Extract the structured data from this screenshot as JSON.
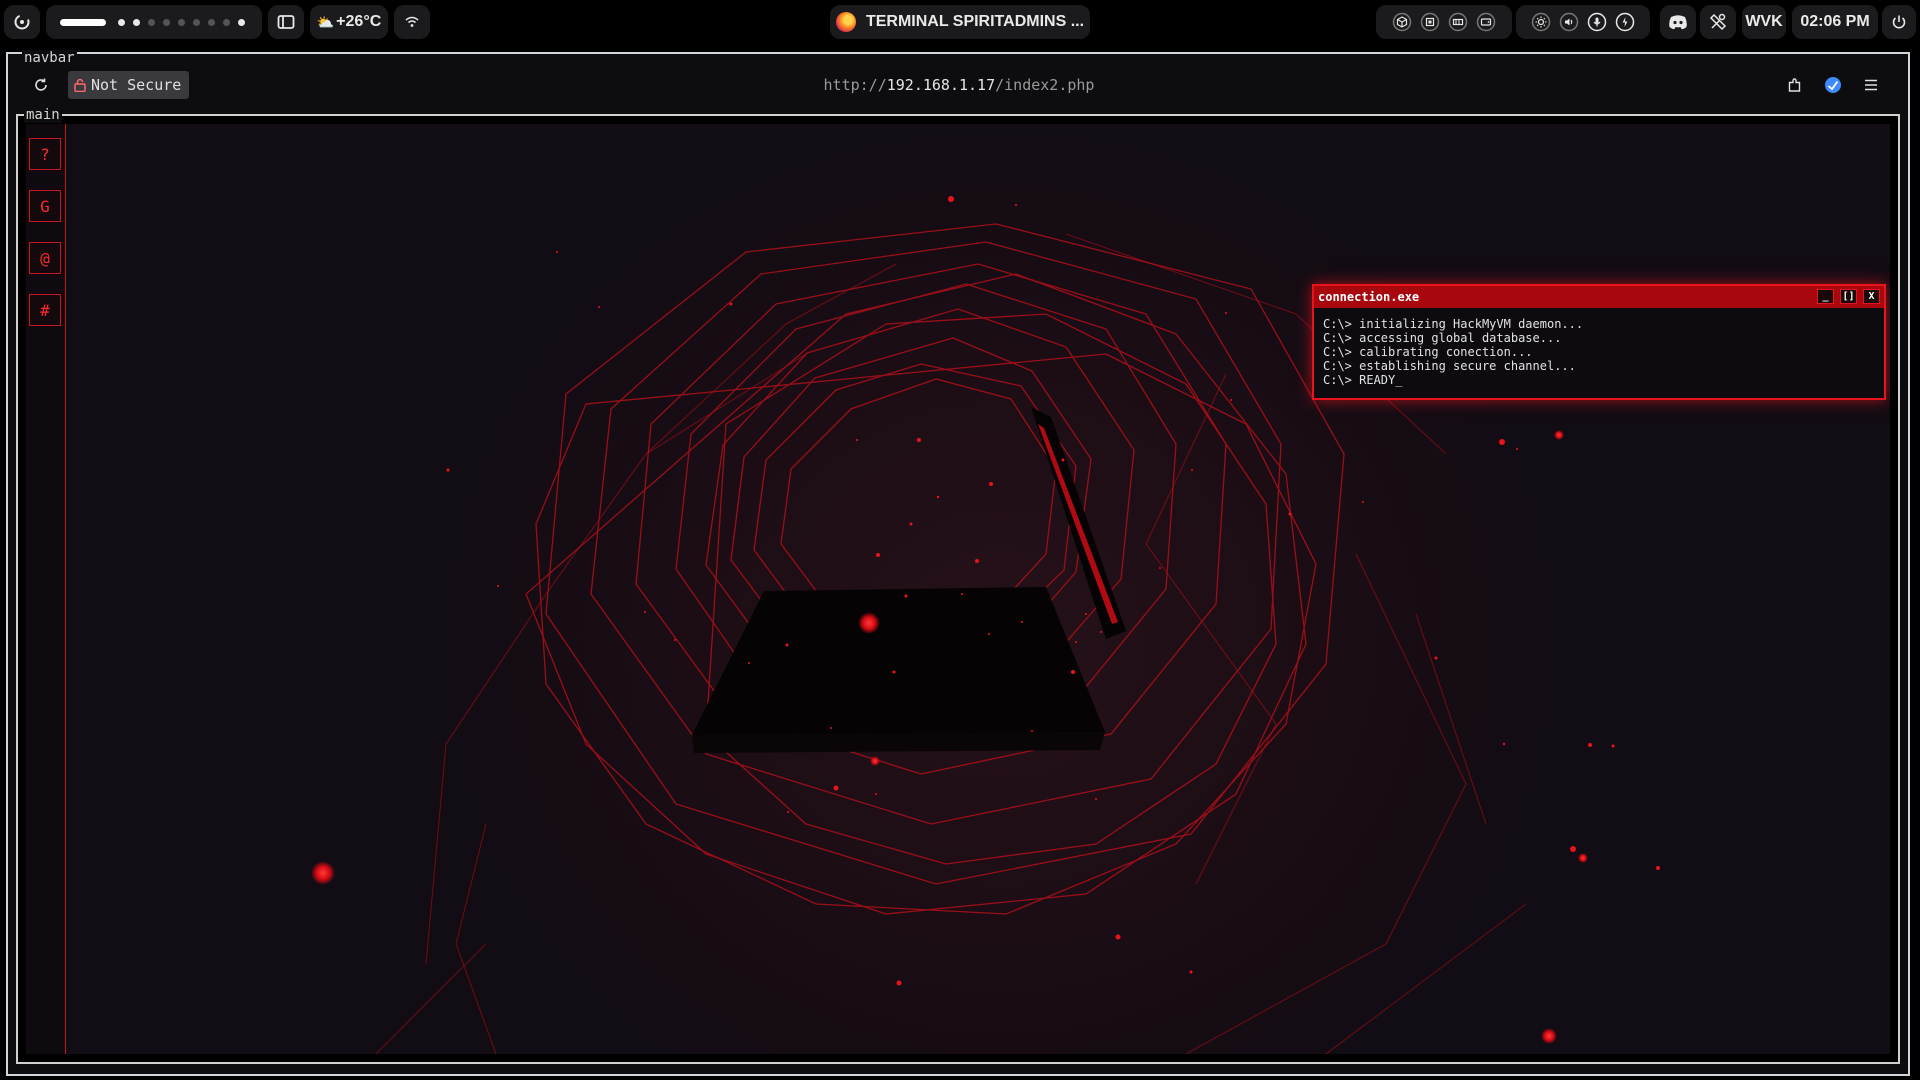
{
  "topbar": {
    "weather": "+26°C",
    "window_title": "TERMINAL SPIRITADMINS ...",
    "user": "WVK",
    "clock": "02:06 PM",
    "workspaces": {
      "count": 10,
      "active": 0,
      "occupied": [
        1,
        2,
        9
      ]
    }
  },
  "browser": {
    "navbar_label": "navbar",
    "main_label": "main",
    "security_label": "Not Secure",
    "url_scheme": "http://",
    "url_host": "192.168.1.17",
    "url_path": "/index2.php"
  },
  "sidebar": {
    "buttons": [
      "?",
      "G",
      "@",
      "#"
    ]
  },
  "terminal": {
    "title": "connection.exe",
    "controls": [
      "_",
      "[]",
      "X"
    ],
    "lines": [
      "C:\\> initializing HackMyVM daemon...",
      "C:\\> accessing global database...",
      "C:\\> calibrating conection...",
      "C:\\> establishing secure channel...",
      "C:\\> READY_"
    ]
  },
  "colors": {
    "accent_red": "#e8141c",
    "title_red": "#a8070d",
    "background": "#120c14"
  }
}
